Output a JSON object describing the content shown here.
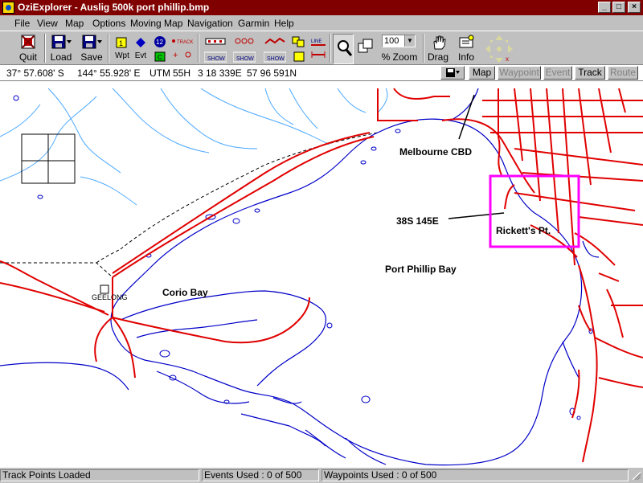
{
  "window": {
    "title": "OziExplorer - Auslig 500k port phillip.bmp",
    "minimize": "_",
    "maximize": "□",
    "close": "×"
  },
  "menu": [
    "File",
    "View",
    "Map",
    "Options",
    "Moving Map",
    "Navigation",
    "Garmin",
    "Help"
  ],
  "toolbar": {
    "quit": "Quit",
    "load": "Load",
    "save": "Save",
    "wpt": "Wpt",
    "evt": "Evt",
    "track_mini": "TRACK",
    "show1": "SHOW",
    "show2": "SHOW",
    "show3": "SHOW",
    "line": "LINE",
    "zoom_value": "100",
    "zoom_label": "% Zoom",
    "drag": "Drag",
    "info": "Info"
  },
  "coords": {
    "lat": "37° 57.608' S",
    "lon": "144° 55.928' E",
    "utm_label": "UTM",
    "zone": "55H",
    "easting": "3 18 339E",
    "northing": "57 96 591N"
  },
  "tabs": {
    "map": "Map",
    "waypoint": "Waypoint",
    "event": "Event",
    "track": "Track",
    "route": "Route"
  },
  "map_labels": {
    "melbourne": "Melbourne CBD",
    "grid": "38S 145E",
    "ricketts": "Rickett's Pt.",
    "port_phillip": "Port Phillip Bay",
    "corio": "Corio Bay",
    "geelong": "GEELONG"
  },
  "status": {
    "main": "Track Points Loaded",
    "events": "Events Used : 0 of 500",
    "waypoints": "Waypoints Used : 0 of 500"
  },
  "colors": {
    "title_bg": "#800000",
    "road": "#e00000",
    "water": "#0000c8",
    "river": "#4aa8ff",
    "highlight": "#ff00ff"
  }
}
